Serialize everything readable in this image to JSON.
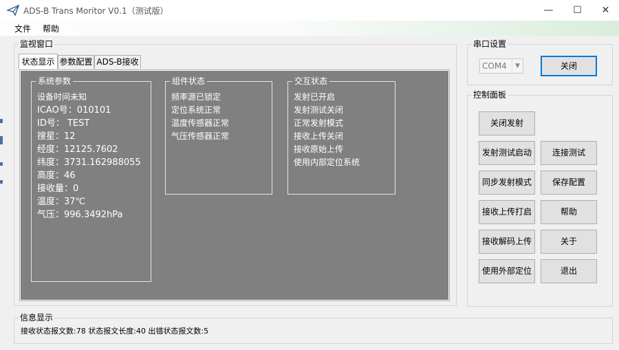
{
  "window": {
    "title": "ADS-B Trans Moritor V0.1（测试版）",
    "minimize": "—",
    "maximize": "☐",
    "close": "✕"
  },
  "menu": {
    "items": [
      "文件",
      "帮助"
    ]
  },
  "monitor": {
    "title": "监视窗口",
    "tabs": [
      "状态显示",
      "参数配置",
      "ADS-B接收"
    ],
    "active_tab": 0
  },
  "system_params": {
    "title": "系统参数",
    "lines": [
      "设备时间未知",
      "ICAO号：010101",
      "ID号：   TEST",
      "搜星：12",
      "经度：12125.7602",
      "纬度：3731.162988055",
      "高度：46",
      "接收量：0",
      "温度：37℃",
      "气压：996.3492hPa"
    ]
  },
  "component_status": {
    "title": "组件状态",
    "lines": [
      "频率源已锁定",
      "定位系统正常",
      "温度传感器正常",
      "气压传感器正常"
    ]
  },
  "interaction_status": {
    "title": "交互状态",
    "lines": [
      "发射已开启",
      "发射测试关闭",
      "正常发射模式",
      "接收上传关闭",
      "接收原始上传",
      "使用内部定位系统"
    ]
  },
  "serial": {
    "title": "串口设置",
    "port_value": "COM4",
    "close_label": "关闭"
  },
  "control": {
    "title": "控制面板",
    "buttons": {
      "close_tx": "关闭发射",
      "tx_test_start": "发射测试启动",
      "link_test": "连接测试",
      "sync_tx_mode": "同步发射模式",
      "save_config": "保存配置",
      "rx_upload_on": "接收上传打启",
      "help": "帮助",
      "rx_decode_upload": "接收解码上传",
      "about": "关于",
      "use_external_pos": "使用外部定位",
      "exit": "退出"
    }
  },
  "info": {
    "title": "信息显示",
    "text": "接收状态报文数:78  状态报文长度:40  出错状态报文数:5"
  }
}
